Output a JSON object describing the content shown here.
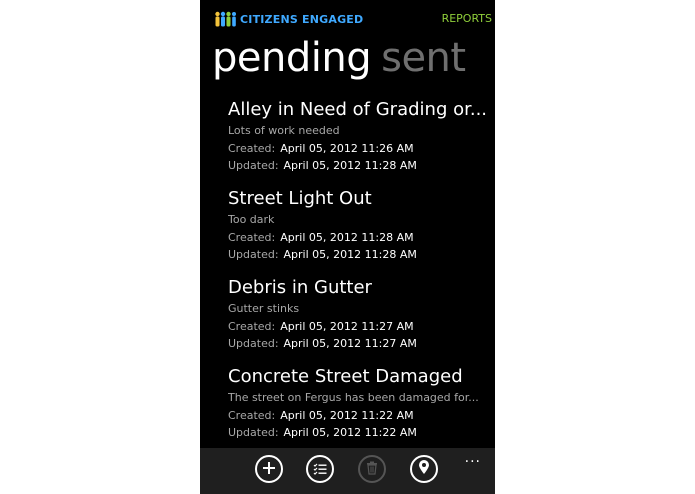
{
  "app": {
    "title": "CITIZENS ENGAGED",
    "header_link": "REPORTS",
    "logo_icon": "people-icon",
    "colors": {
      "title": "#3fa9ff",
      "link": "#8fce3a",
      "background": "#000000"
    }
  },
  "pivot": {
    "active": "pending",
    "inactive": "sent"
  },
  "labels": {
    "created": "Created:",
    "updated": "Updated:"
  },
  "items": [
    {
      "title": "Alley in Need of Grading or...",
      "description": "Lots of work needed",
      "created": "April 05, 2012 11:26 AM",
      "updated": "April 05, 2012 11:28 AM"
    },
    {
      "title": "Street Light Out",
      "description": "Too dark",
      "created": "April 05, 2012 11:28 AM",
      "updated": "April 05, 2012 11:28 AM"
    },
    {
      "title": "Debris in Gutter",
      "description": "Gutter stinks",
      "created": "April 05, 2012 11:27 AM",
      "updated": "April 05, 2012 11:27 AM"
    },
    {
      "title": "Concrete Street Damaged",
      "description": "The street on Fergus has been damaged for...",
      "created": "April 05, 2012 11:22 AM",
      "updated": "April 05, 2012 11:22 AM"
    }
  ],
  "appbar": {
    "buttons": [
      {
        "icon": "add-icon",
        "enabled": true
      },
      {
        "icon": "list-icon",
        "enabled": true
      },
      {
        "icon": "delete-icon",
        "enabled": false
      },
      {
        "icon": "location-icon",
        "enabled": true
      }
    ],
    "more": "..."
  }
}
